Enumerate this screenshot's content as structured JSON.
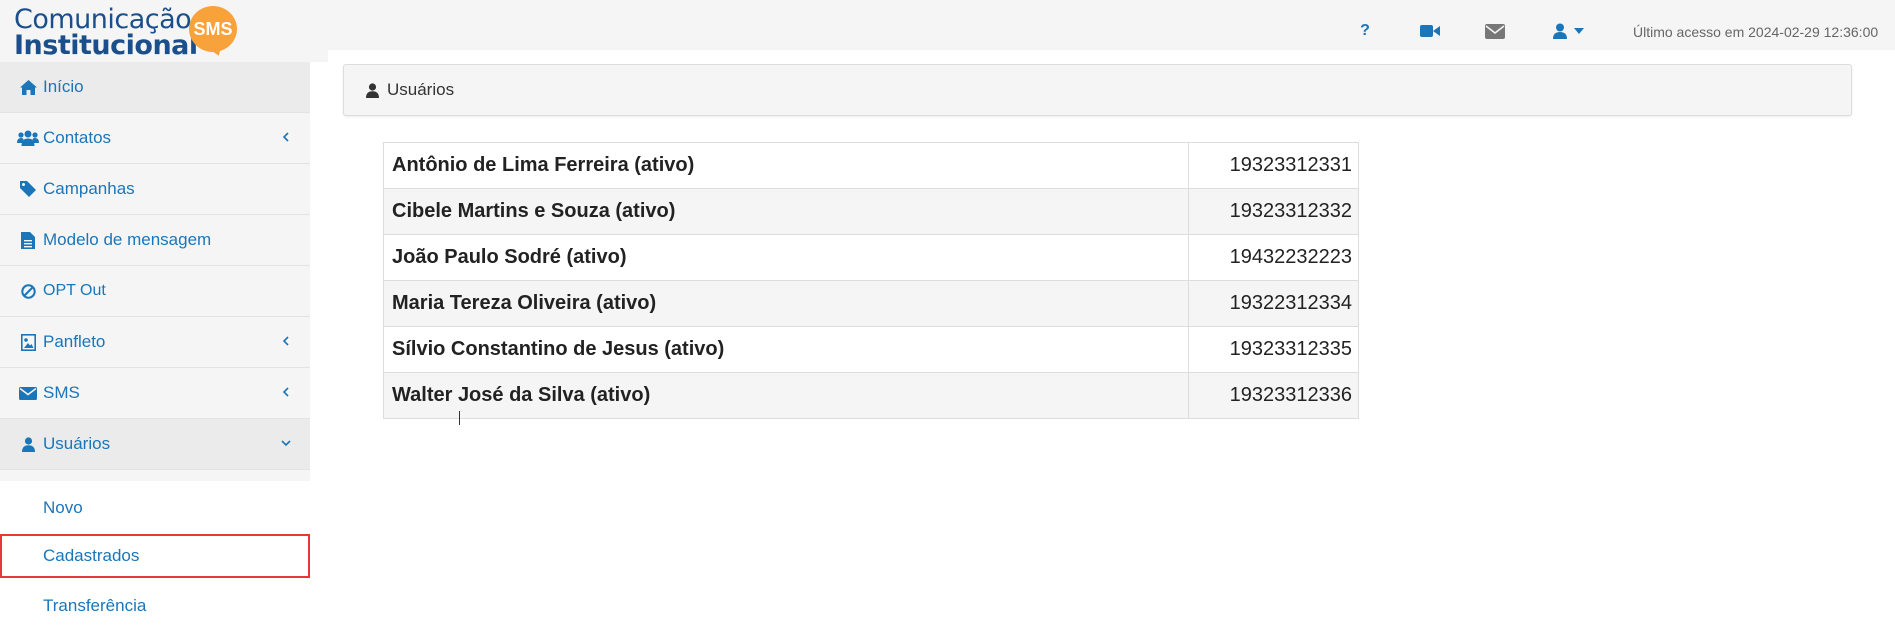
{
  "logo": {
    "line1": "Comunicação",
    "line2": "Institucional",
    "badge": "SMS",
    "badge_color": "#f7a23b"
  },
  "header": {
    "help_label": "?",
    "icons": [
      "question-icon",
      "video-camera-icon",
      "envelope-icon",
      "user-icon",
      "caret-down-icon"
    ],
    "last_access": "Último acesso em 2024-02-29 12:36:00"
  },
  "sidebar": {
    "items": [
      {
        "label": "Início",
        "icon": "home-icon"
      },
      {
        "label": "Contatos",
        "icon": "users-icon",
        "chevron": "left"
      },
      {
        "label": "Campanhas",
        "icon": "tag-icon"
      },
      {
        "label": "Modelo de mensagem",
        "icon": "file-text-icon"
      },
      {
        "label": "OPT Out",
        "icon": "ban-icon"
      },
      {
        "label": "Panfleto",
        "icon": "image-icon",
        "chevron": "left"
      },
      {
        "label": "SMS",
        "icon": "envelope-icon",
        "chevron": "left"
      },
      {
        "label": "Usuários",
        "icon": "user-icon",
        "chevron": "down"
      }
    ],
    "submenu": [
      {
        "label": "Novo"
      },
      {
        "label": "Cadastrados",
        "selected": true
      },
      {
        "label": "Transferência"
      }
    ]
  },
  "panel": {
    "title": "Usuários"
  },
  "users": {
    "rows": [
      {
        "name": "Antônio de Lima Ferreira (ativo)",
        "phone": "19323312331"
      },
      {
        "name": "Cibele Martins e Souza (ativo)",
        "phone": "19323312332"
      },
      {
        "name": "João Paulo Sodré (ativo)",
        "phone": "19432232223"
      },
      {
        "name": "Maria Tereza Oliveira (ativo)",
        "phone": "19322312334"
      },
      {
        "name": "Sílvio Constantino de Jesus (ativo)",
        "phone": "19323312335"
      },
      {
        "name": "Walter José da Silva (ativo)",
        "phone": "19323312336"
      }
    ]
  },
  "colors": {
    "link": "#1a76b9",
    "brand": "#1a4f8c",
    "selection_outline": "#e53935"
  }
}
